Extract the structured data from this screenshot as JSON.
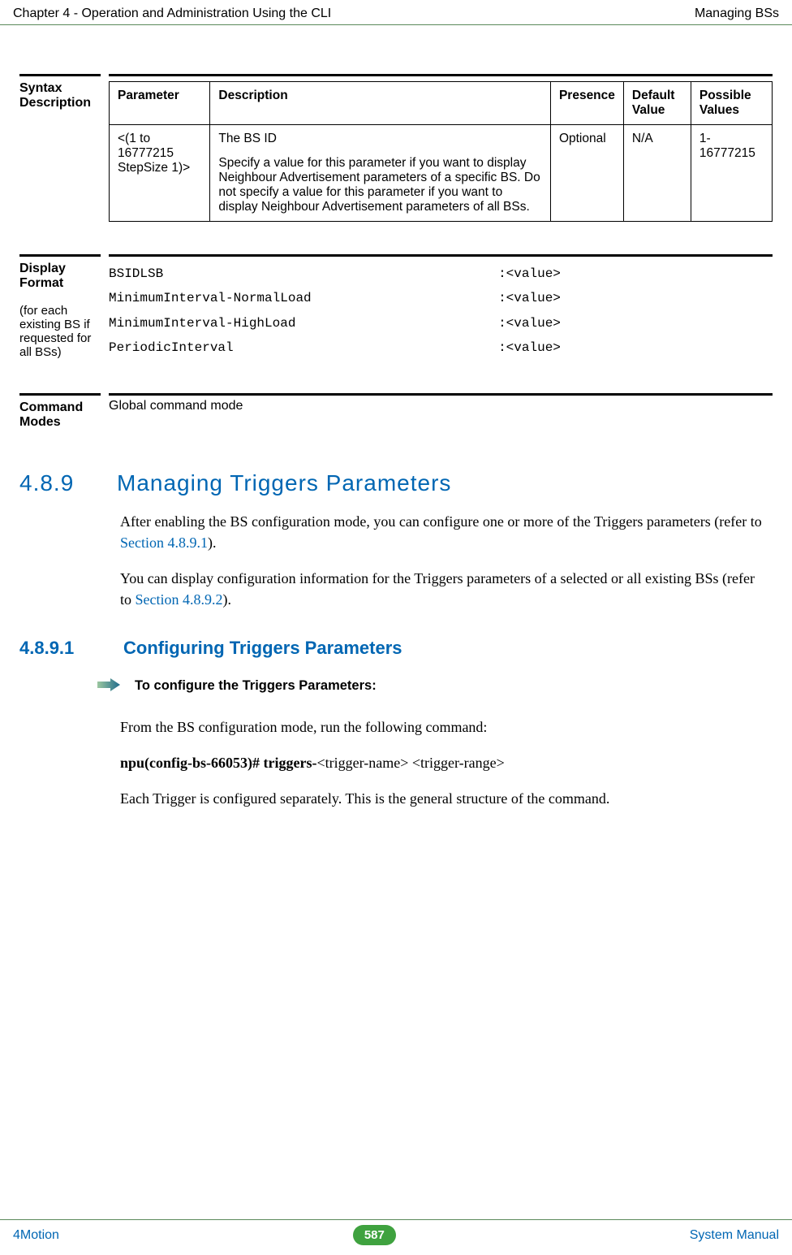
{
  "header": {
    "left": "Chapter 4 - Operation and Administration Using the CLI",
    "right": "Managing BSs"
  },
  "syntax": {
    "label": "Syntax Description",
    "headers": {
      "parameter": "Parameter",
      "description": "Description",
      "presence": "Presence",
      "default": "Default Value",
      "possible": "Possible Values"
    },
    "row": {
      "parameter": "<(1 to 16777215 StepSize 1)>",
      "desc_line1": "The BS ID",
      "desc_rest": "Specify a value for this parameter if you want to display Neighbour Advertisement parameters of a specific BS. Do not specify a value for this parameter if you want to display Neighbour Advertisement parameters of all BSs.",
      "presence": "Optional",
      "default": "N/A",
      "possible": "1-16777215"
    }
  },
  "display": {
    "label": "Display Format",
    "sub": "(for each existing BS if requested for all BSs)",
    "lines": "BSIDLSB                                           :<value>\nMinimumInterval-NormalLoad                        :<value>\nMinimumInterval-HighLoad                          :<value>\nPeriodicInterval                                  :<value>"
  },
  "cmdmode": {
    "label": "Command Modes",
    "text": "Global command mode"
  },
  "section489": {
    "num": "4.8.9",
    "title": "Managing Triggers Parameters",
    "p1_a": "After enabling the BS configuration mode, you can configure one or more of the Triggers parameters (refer to ",
    "p1_link": "Section 4.8.9.1",
    "p1_b": ").",
    "p2_a": "You can display configuration information for the Triggers parameters of a selected or all existing BSs (refer to ",
    "p2_link": "Section 4.8.9.2",
    "p2_b": ")."
  },
  "section4891": {
    "num": "4.8.9.1",
    "title": "Configuring Triggers Parameters"
  },
  "instruction": {
    "heading": "To configure the Triggers Parameters:",
    "p1": "From the BS configuration mode, run the following command:",
    "cmd_bold": "npu(config-bs-66053)# triggers-",
    "cmd_rest": "<trigger-name> <trigger-range>",
    "p2": "Each Trigger is configured separately. This is the general structure of the command."
  },
  "footer": {
    "left": "4Motion",
    "page": "587",
    "right": "System Manual"
  }
}
